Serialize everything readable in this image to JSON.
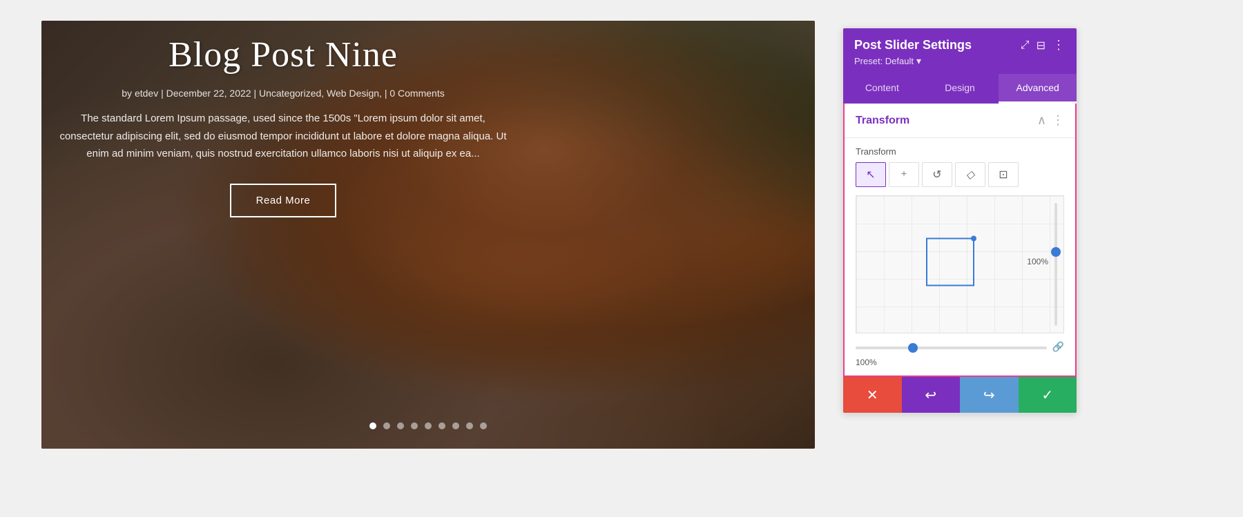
{
  "slider": {
    "title": "Blog Post Nine",
    "meta": "by etdev | December 22, 2022 | Uncategorized, Web Design, | 0 Comments",
    "excerpt": "The standard Lorem Ipsum passage, used since the 1500s \"Lorem ipsum dolor sit amet, consectetur adipiscing elit, sed do eiusmod tempor incididunt ut labore et dolore magna aliqua. Ut enim ad minim veniam, quis nostrud exercitation ullamco laboris nisi ut aliquip ex ea...",
    "read_more": "Read More",
    "dots": [
      {
        "active": true
      },
      {
        "active": false
      },
      {
        "active": false
      },
      {
        "active": false
      },
      {
        "active": false
      },
      {
        "active": false
      },
      {
        "active": false
      },
      {
        "active": false
      },
      {
        "active": false
      }
    ]
  },
  "panel": {
    "title": "Post Slider Settings",
    "preset_label": "Preset: Default",
    "tabs": [
      {
        "label": "Content",
        "active": false
      },
      {
        "label": "Design",
        "active": false
      },
      {
        "label": "Advanced",
        "active": true
      }
    ],
    "transform_section": {
      "title": "Transform",
      "label": "Transform",
      "tools": [
        {
          "icon": "↖",
          "name": "move-tool",
          "active": true
        },
        {
          "icon": "+",
          "name": "add-tool",
          "active": false
        },
        {
          "icon": "↺",
          "name": "rotate-tool",
          "active": false
        },
        {
          "icon": "◇",
          "name": "skew-tool",
          "active": false
        },
        {
          "icon": "⊞",
          "name": "scale-tool",
          "active": false
        }
      ],
      "scale_x": "100%",
      "scale_y": "100%"
    }
  },
  "actions": {
    "cancel": "✕",
    "reset": "↩",
    "redo": "↪",
    "save": "✓"
  },
  "colors": {
    "purple": "#7b2fbe",
    "pink_border": "#e83e8c",
    "blue": "#3a7bd5",
    "red": "#e74c3c",
    "green": "#27ae60"
  }
}
